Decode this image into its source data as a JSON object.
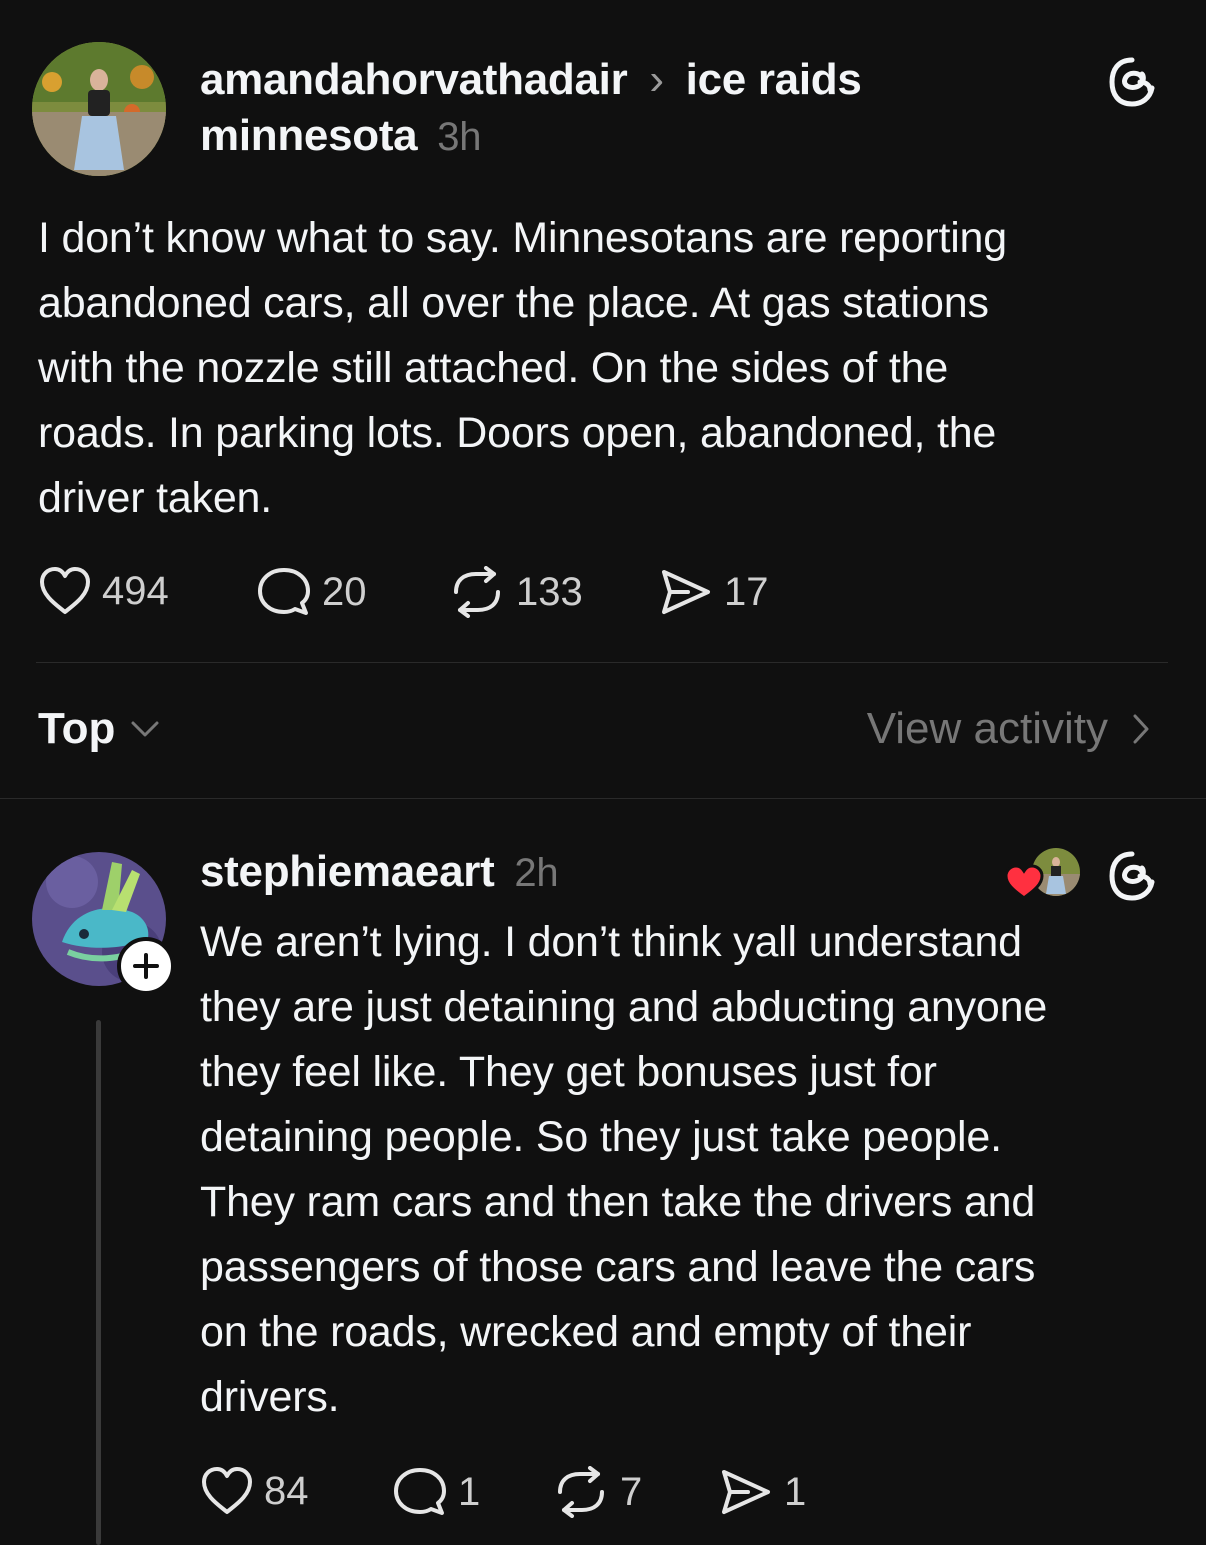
{
  "post": {
    "username": "amandahorvathadair",
    "separator": "›",
    "topic_line1": "ice raids",
    "topic_line2": "minnesota",
    "time": "3h",
    "text_lines": [
      "I don’t know what to say. Minnesotans are reporting",
      "abandoned cars, all over the place. At gas stations",
      "with the nozzle still attached. On the sides of the",
      "roads. In parking lots. Doors open, abandoned, the",
      "driver taken."
    ],
    "actions": {
      "likes": "494",
      "comments": "20",
      "reposts": "133",
      "shares": "17"
    }
  },
  "sort": {
    "label": "Top",
    "view_activity": "View activity"
  },
  "reply": {
    "username": "stephiemaeart",
    "time": "2h",
    "text_lines": [
      "We aren’t lying. I don’t think yall understand",
      "they are just detaining and abducting anyone",
      "they feel like. They get bonuses just for",
      "detaining people. So they just take people.",
      "They ram cars and then take the drivers and",
      "passengers of those cars and leave the cars",
      "on the roads, wrecked and empty of their",
      "drivers."
    ],
    "actions": {
      "likes": "84",
      "comments": "1",
      "reposts": "7",
      "shares": "1"
    }
  },
  "colors": {
    "background": "#101010",
    "text": "#f3f5f7",
    "muted": "#777777",
    "liked_heart": "#ff3040"
  }
}
